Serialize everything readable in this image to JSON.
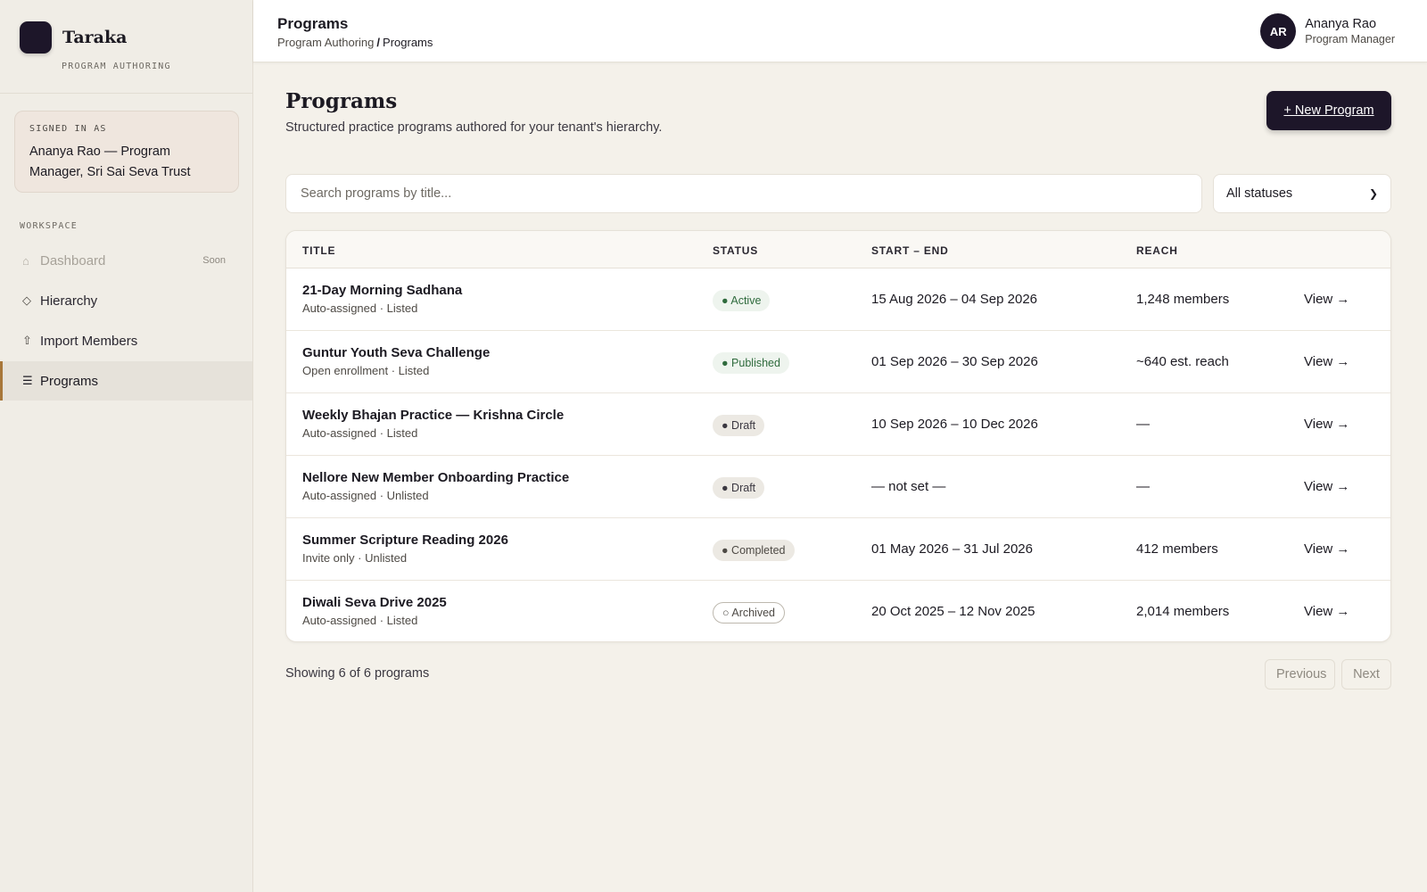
{
  "brand": {
    "name": "Taraka",
    "subtitle": "PROGRAM AUTHORING"
  },
  "signed_in": {
    "label": "SIGNED IN AS",
    "name": "Ananya Rao — Program Manager, Sri Sai Seva Trust"
  },
  "sidebar": {
    "section_label": "WORKSPACE",
    "items": [
      {
        "label": "Dashboard",
        "icon": "home-icon",
        "glyph": "⌂",
        "badge": "Soon",
        "disabled": true,
        "active": false
      },
      {
        "label": "Hierarchy",
        "icon": "diamond-icon",
        "glyph": "◇",
        "disabled": false,
        "active": false
      },
      {
        "label": "Import Members",
        "icon": "upload-icon",
        "glyph": "⇧",
        "disabled": false,
        "active": false
      },
      {
        "label": "Programs",
        "icon": "list-icon",
        "glyph": "☰",
        "disabled": false,
        "active": true
      }
    ]
  },
  "header": {
    "title": "Programs",
    "breadcrumb": {
      "parent": "Program Authoring",
      "separator": "/",
      "current": "Programs"
    },
    "user": {
      "initials": "AR",
      "name": "Ananya Rao",
      "role": "Program Manager"
    }
  },
  "main": {
    "title": "Programs",
    "subtitle": "Structured practice programs authored for your tenant's hierarchy.",
    "new_button": "+ New Program",
    "search_placeholder": "Search programs by title...",
    "status_filter": "All statuses",
    "table": {
      "columns": [
        "TITLE",
        "STATUS",
        "START – END",
        "REACH"
      ],
      "rows": [
        {
          "title": "21-Day Morning Sadhana",
          "meta": "Auto-assigned · Listed",
          "status": "Active",
          "status_glyph": "●",
          "dates": "15 Aug 2026 – 04 Sep 2026",
          "reach": "1,248 members",
          "action": "View →"
        },
        {
          "title": "Guntur Youth Seva Challenge",
          "meta": "Open enrollment · Listed",
          "status": "Published",
          "status_glyph": "●",
          "dates": "01 Sep 2026 – 30 Sep 2026",
          "reach": "~640 est. reach",
          "action": "View →"
        },
        {
          "title": "Weekly Bhajan Practice — Krishna Circle",
          "meta": "Auto-assigned · Listed",
          "status": "Draft",
          "status_glyph": "●",
          "dates": "10 Sep 2026 – 10 Dec 2026",
          "reach": "—",
          "action": "View →"
        },
        {
          "title": "Nellore New Member Onboarding Practice",
          "meta": "Auto-assigned · Unlisted",
          "status": "Draft",
          "status_glyph": "●",
          "dates": "— not set —",
          "reach": "—",
          "action": "View →"
        },
        {
          "title": "Summer Scripture Reading 2026",
          "meta": "Invite only · Unlisted",
          "status": "Completed",
          "status_glyph": "●",
          "dates": "01 May 2026 – 31 Jul 2026",
          "reach": "412 members",
          "action": "View →"
        },
        {
          "title": "Diwali Seva Drive 2025",
          "meta": "Auto-assigned · Listed",
          "status": "Archived",
          "status_glyph": "○",
          "dates": "20 Oct 2025 – 12 Nov 2025",
          "reach": "2,014 members",
          "action": "View →"
        }
      ]
    },
    "footer": {
      "showing": "Showing 6 of 6 programs",
      "previous": "Previous",
      "next": "Next"
    }
  },
  "colors": {
    "accent": "#1d1629",
    "active_indicator": "#a8773a",
    "status_green": "#2f6b3d",
    "background": "#f4f1ea"
  }
}
